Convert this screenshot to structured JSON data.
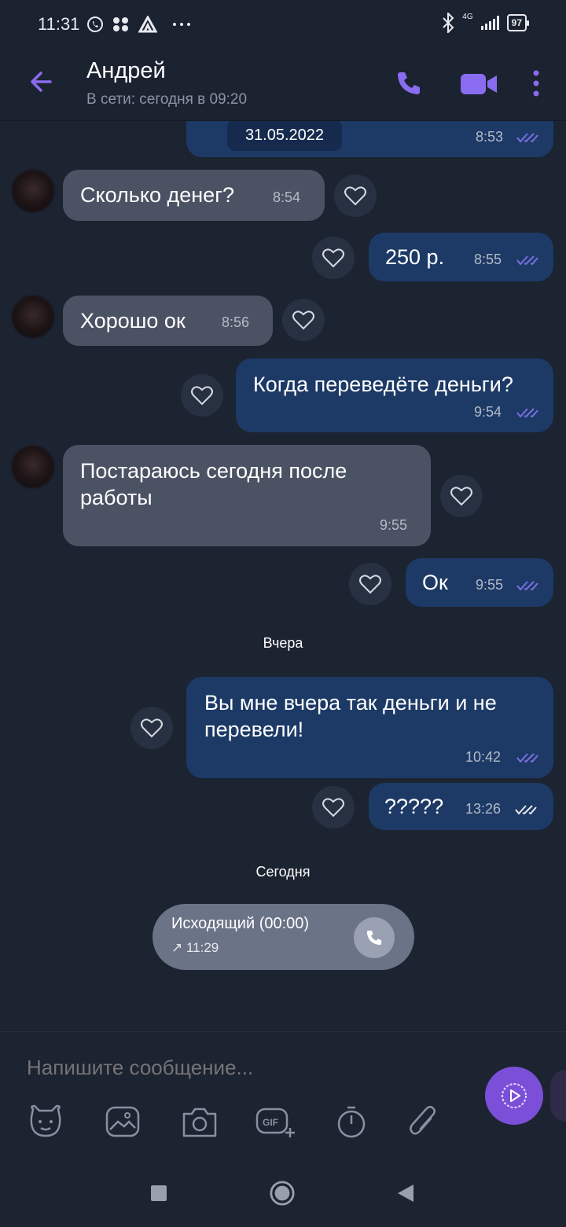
{
  "status_bar": {
    "time": "11:31",
    "left_icons": [
      "viber-icon",
      "apps-icon",
      "vector-icon",
      "more-dots-icon"
    ],
    "network": "4G",
    "battery": "97"
  },
  "header": {
    "contact_name": "Андрей",
    "contact_status": "В сети: сегодня в 09:20"
  },
  "messages": [
    {
      "id": "m0",
      "direction": "out",
      "text": "31.05.2022",
      "time": "8:53"
    },
    {
      "id": "m1",
      "direction": "in",
      "text": "Сколько денег?",
      "time": "8:54"
    },
    {
      "id": "m2",
      "direction": "out",
      "text": "250 р.",
      "time": "8:55"
    },
    {
      "id": "m3",
      "direction": "in",
      "text": "Хорошо ок",
      "time": "8:56"
    },
    {
      "id": "m4",
      "direction": "out",
      "text": "Когда переведёте деньги?",
      "time": "9:54"
    },
    {
      "id": "m5",
      "direction": "in",
      "text": "Постараюсь сегодня после работы",
      "time": "9:55"
    },
    {
      "id": "m6",
      "direction": "out",
      "text": "Ок",
      "time": "9:55"
    },
    {
      "id": "m7",
      "direction": "out",
      "text": "Вы мне вчера так деньги и не перевели!",
      "time": "10:42"
    },
    {
      "id": "m8",
      "direction": "out",
      "text": "?????",
      "time": "13:26"
    }
  ],
  "day_separators": {
    "yesterday": "Вчера",
    "today": "Сегодня"
  },
  "call": {
    "title": "Исходящий (00:00)",
    "time": "↗ 11:29"
  },
  "composer": {
    "placeholder": "Напишите сообщение..."
  },
  "colors": {
    "background": "#1c2331",
    "incoming_bubble": "#4b5263",
    "outgoing_bubble": "#1d3a66",
    "accent": "#7b4fd8",
    "read_ticks": "#7b6fe0"
  }
}
